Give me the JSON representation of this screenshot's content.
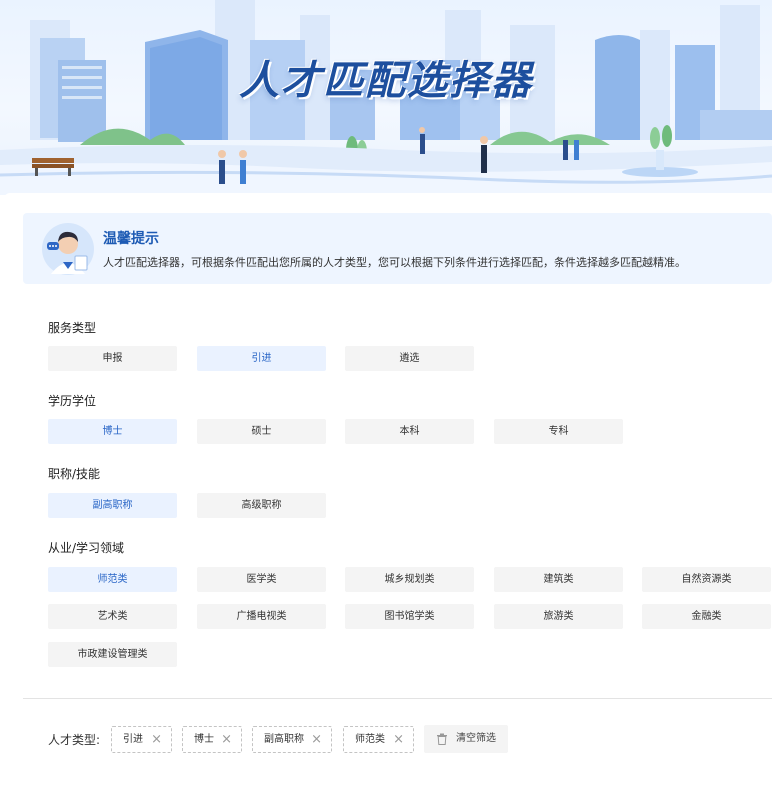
{
  "banner": {
    "title": "人才匹配选择器"
  },
  "tip": {
    "title": "温馨提示",
    "text": "人才匹配选择器，可根据条件匹配出您所属的人才类型，您可以根据下列条件进行选择匹配，条件选择越多匹配越精准。"
  },
  "sections": {
    "service": {
      "title": "服务类型",
      "options": [
        "申报",
        "引进",
        "遴选"
      ],
      "selected": "引进"
    },
    "education": {
      "title": "学历学位",
      "options": [
        "博士",
        "硕士",
        "本科",
        "专科"
      ],
      "selected": "博士"
    },
    "title_skill": {
      "title": "职称/技能",
      "options": [
        "副高职称",
        "高级职称"
      ],
      "selected": "副高职称"
    },
    "field": {
      "title": "从业/学习领域",
      "options": [
        "师范类",
        "医学类",
        "城乡规划类",
        "建筑类",
        "自然资源类",
        "艺术类",
        "广播电视类",
        "图书馆学类",
        "旅游类",
        "金融类",
        "市政建设管理类"
      ],
      "selected": "师范类"
    }
  },
  "selection": {
    "label": "人才类型:",
    "chips": [
      "引进",
      "博士",
      "副高职称",
      "师范类"
    ],
    "clear_label": "清空筛选"
  },
  "colors": {
    "accent": "#2764c6",
    "active_bg": "#eaf2ff",
    "tip_bg": "#eef5ff",
    "title": "#1d4f9e"
  },
  "icons": {
    "remove": "close-icon",
    "clear": "trash-icon",
    "avatar": "assistant-avatar-icon"
  }
}
